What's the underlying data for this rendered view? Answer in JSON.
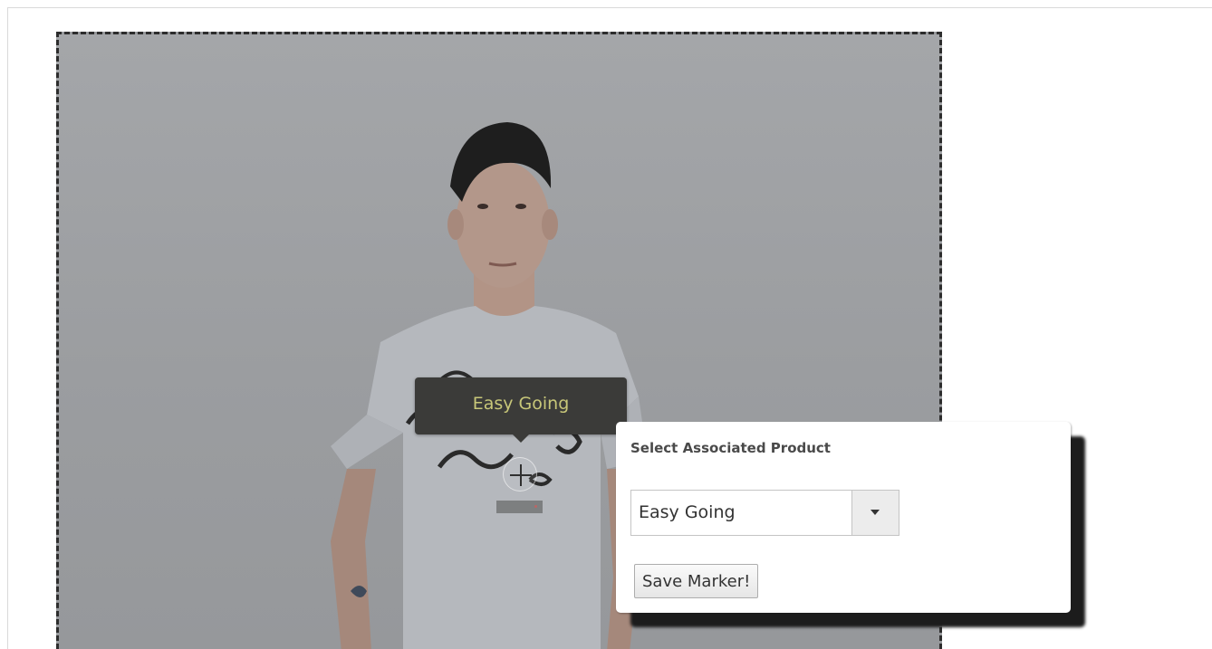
{
  "tooltip": {
    "label": "Easy Going"
  },
  "popup": {
    "title": "Select Associated Product",
    "product_select": {
      "selected": "Easy Going"
    },
    "save_label": "Save Marker!"
  },
  "icons": {
    "marker": "plus-icon",
    "select_toggle": "triangle-down-icon"
  },
  "colors": {
    "tooltip_bg": "#3b3b39",
    "tooltip_text": "#c8c779",
    "image_overlay": "#9d9fa2"
  }
}
